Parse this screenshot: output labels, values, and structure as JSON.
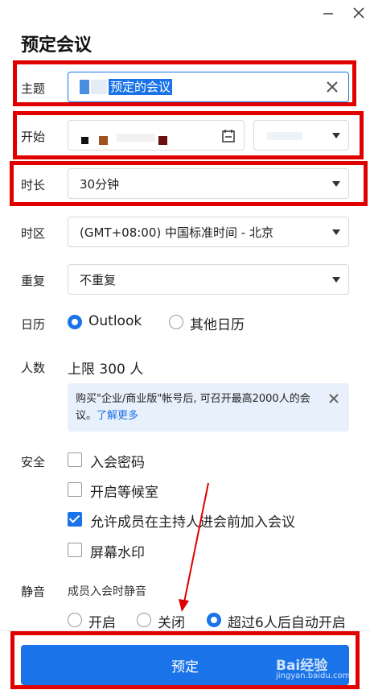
{
  "window": {
    "minimize_icon": "minimize-icon",
    "close_icon": "close-icon"
  },
  "title": "预定会议",
  "subject": {
    "label": "主题",
    "value": "预定的会议"
  },
  "start": {
    "label": "开始"
  },
  "duration": {
    "label": "时长",
    "value": "30分钟"
  },
  "timezone": {
    "label": "时区",
    "value": "(GMT+08:00) 中国标准时间 - 北京"
  },
  "repeat": {
    "label": "重复",
    "value": "不重复"
  },
  "calendar": {
    "label": "日历",
    "options": [
      "Outlook",
      "其他日历"
    ],
    "selected": "Outlook"
  },
  "participants": {
    "label": "人数",
    "value": "上限 300 人",
    "notice_text": "购买\"企业/商业版\"帐号后, 可召开最高2000人的会议。",
    "notice_link": "了解更多"
  },
  "security": {
    "label": "安全",
    "options": [
      {
        "label": "入会密码",
        "checked": false
      },
      {
        "label": "开启等候室",
        "checked": false
      },
      {
        "label": "允许成员在主持人进会前加入会议",
        "checked": true
      },
      {
        "label": "屏幕水印",
        "checked": false
      }
    ]
  },
  "mute": {
    "label": "静音",
    "sub_label": "成员入会时静音",
    "options": [
      "开启",
      "关闭",
      "超过6人后自动开启"
    ],
    "selected": "超过6人后自动开启"
  },
  "submit_label": "预定",
  "watermark": {
    "brand": "Bai经验",
    "url": "jingyan.baidu.com"
  },
  "colors": {
    "accent": "#1a73e8",
    "annotation": "#e00000",
    "notice_bg": "#e8f0fb"
  }
}
